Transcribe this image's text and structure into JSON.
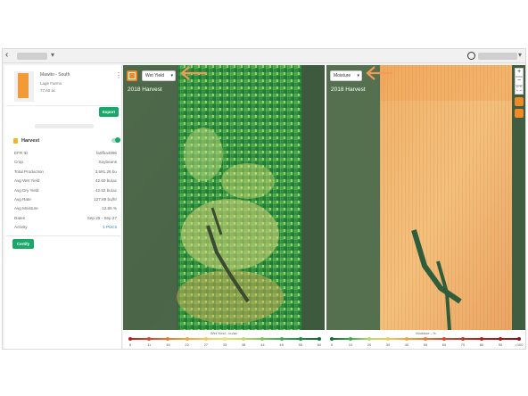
{
  "sidebar": {
    "field": {
      "name": "Mawito - South",
      "farm": "Lage Farms",
      "area": "77.60 ac"
    },
    "export_label": "Export",
    "section_title": "Harvest",
    "rows": [
      {
        "label": "EFR ID",
        "value": "fa0fba4696"
      },
      {
        "label": "Crop",
        "value": "Soybeans"
      },
      {
        "label": "Total Production",
        "value": "3,581.26 bu"
      },
      {
        "label": "Avg Wet Yield",
        "value": "42.50 bu/ac"
      },
      {
        "label": "Avg Dry Yield",
        "value": "42.52 bu/ac"
      },
      {
        "label": "Avg Rate",
        "value": "127.89 bu/hr"
      },
      {
        "label": "Avg Moisture",
        "value": "12.86 %"
      },
      {
        "label": "Dates",
        "value": "Sep 25 - Sep 27"
      },
      {
        "label": "Activity",
        "value": "1 PUCs"
      }
    ],
    "certify_label": "Certify"
  },
  "left_map": {
    "layer_select": "Wet Yield",
    "title": "2018 Harvest",
    "legend": {
      "title": "Wet Yield - bu/ac",
      "ticks": [
        "5",
        "11",
        "16",
        "22",
        "27",
        "33",
        "38",
        "44",
        "49",
        "55",
        "60"
      ],
      "colors": [
        "#b81e1e",
        "#d6452a",
        "#e8792f",
        "#f2a43e",
        "#f4c95a",
        "#e6e07a",
        "#b8d96d",
        "#7fc35f",
        "#3faa52",
        "#1d8c3f",
        "#0f6b2e"
      ]
    }
  },
  "right_map": {
    "layer_select": "Moisture",
    "title": "2018 Harvest",
    "legend": {
      "title": "Moisture - %",
      "ticks": [
        "0",
        "10",
        "20",
        "30",
        "40",
        "50",
        "60",
        "70",
        "80",
        "90",
        ">100"
      ],
      "colors": [
        "#0f6b2e",
        "#3faa52",
        "#b8d96d",
        "#f4c95a",
        "#f2a43e",
        "#e8792f",
        "#d6452a",
        "#c23424",
        "#b81e1e",
        "#a51b1b",
        "#8c1414"
      ]
    }
  },
  "icons": {
    "back": "back-chevron-icon",
    "user": "user-circle-icon",
    "zoom_in": "+",
    "zoom_out": "−",
    "fullscreen": "fullscreen-icon"
  }
}
